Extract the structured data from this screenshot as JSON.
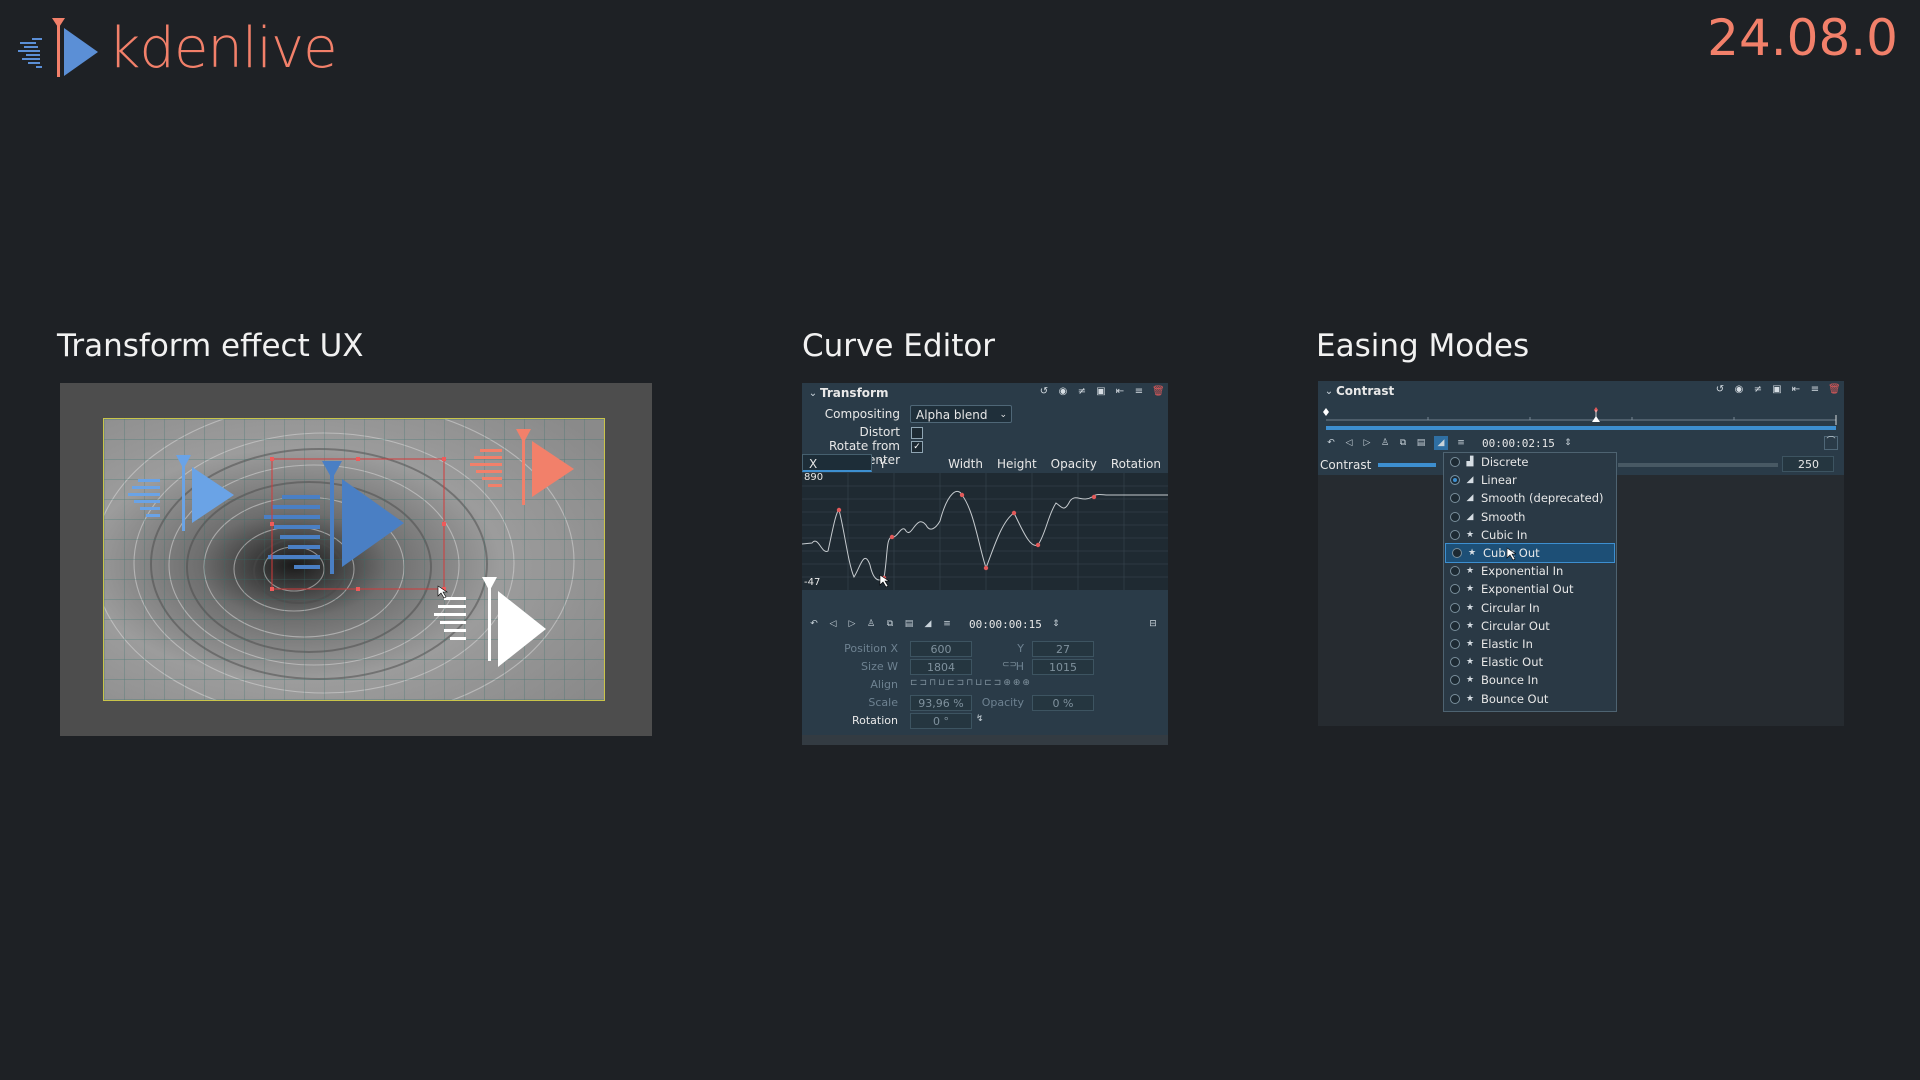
{
  "brand": {
    "name": "kdenlive",
    "version": "24.08.0",
    "accent": "#f2806a",
    "blue": "#5b8fd6"
  },
  "sections": {
    "transform": {
      "title": "Transform effect UX"
    },
    "curve": {
      "title": "Curve Editor"
    },
    "easing": {
      "title": "Easing Modes"
    }
  },
  "curve_editor": {
    "panel_title": "Transform",
    "header_icons": [
      "reset-icon",
      "eye-icon",
      "sliders-icon",
      "save-icon",
      "collapse-icon",
      "menu-icon",
      "delete-icon"
    ],
    "compositing_label": "Compositing",
    "compositing_value": "Alpha blend",
    "distort_label": "Distort",
    "distort_checked": false,
    "rotate_label": "Rotate from center",
    "rotate_checked": true,
    "tabs": [
      "X position",
      "Y position",
      "Width",
      "Height",
      "Opacity",
      "Rotation"
    ],
    "active_tab": "X position",
    "graph_max": "890",
    "graph_min": "-47",
    "timecode": "00:00:00:15",
    "params": {
      "position_x_label": "Position X",
      "position_x": "600",
      "y_label": "Y",
      "y": "27",
      "size_w_label": "Size W",
      "size_w": "1804",
      "h_label": "H",
      "h": "1015",
      "align_label": "Align",
      "scale_label": "Scale",
      "scale": "93,96 %",
      "opacity_label": "Opacity",
      "opacity": "0 %",
      "rotation_label": "Rotation",
      "rotation": "0 °"
    }
  },
  "easing": {
    "panel_title": "Contrast",
    "timecode": "00:00:02:15",
    "param_label": "Contrast",
    "param_value": "250",
    "modes": [
      "Discrete",
      "Linear",
      "Smooth (deprecated)",
      "Smooth",
      "Cubic In",
      "Cubic Out",
      "Exponential In",
      "Exponential Out",
      "Circular In",
      "Circular Out",
      "Elastic In",
      "Elastic Out",
      "Bounce In",
      "Bounce Out"
    ],
    "selected_mode": "Linear",
    "hovered_mode": "Cubic Out"
  }
}
